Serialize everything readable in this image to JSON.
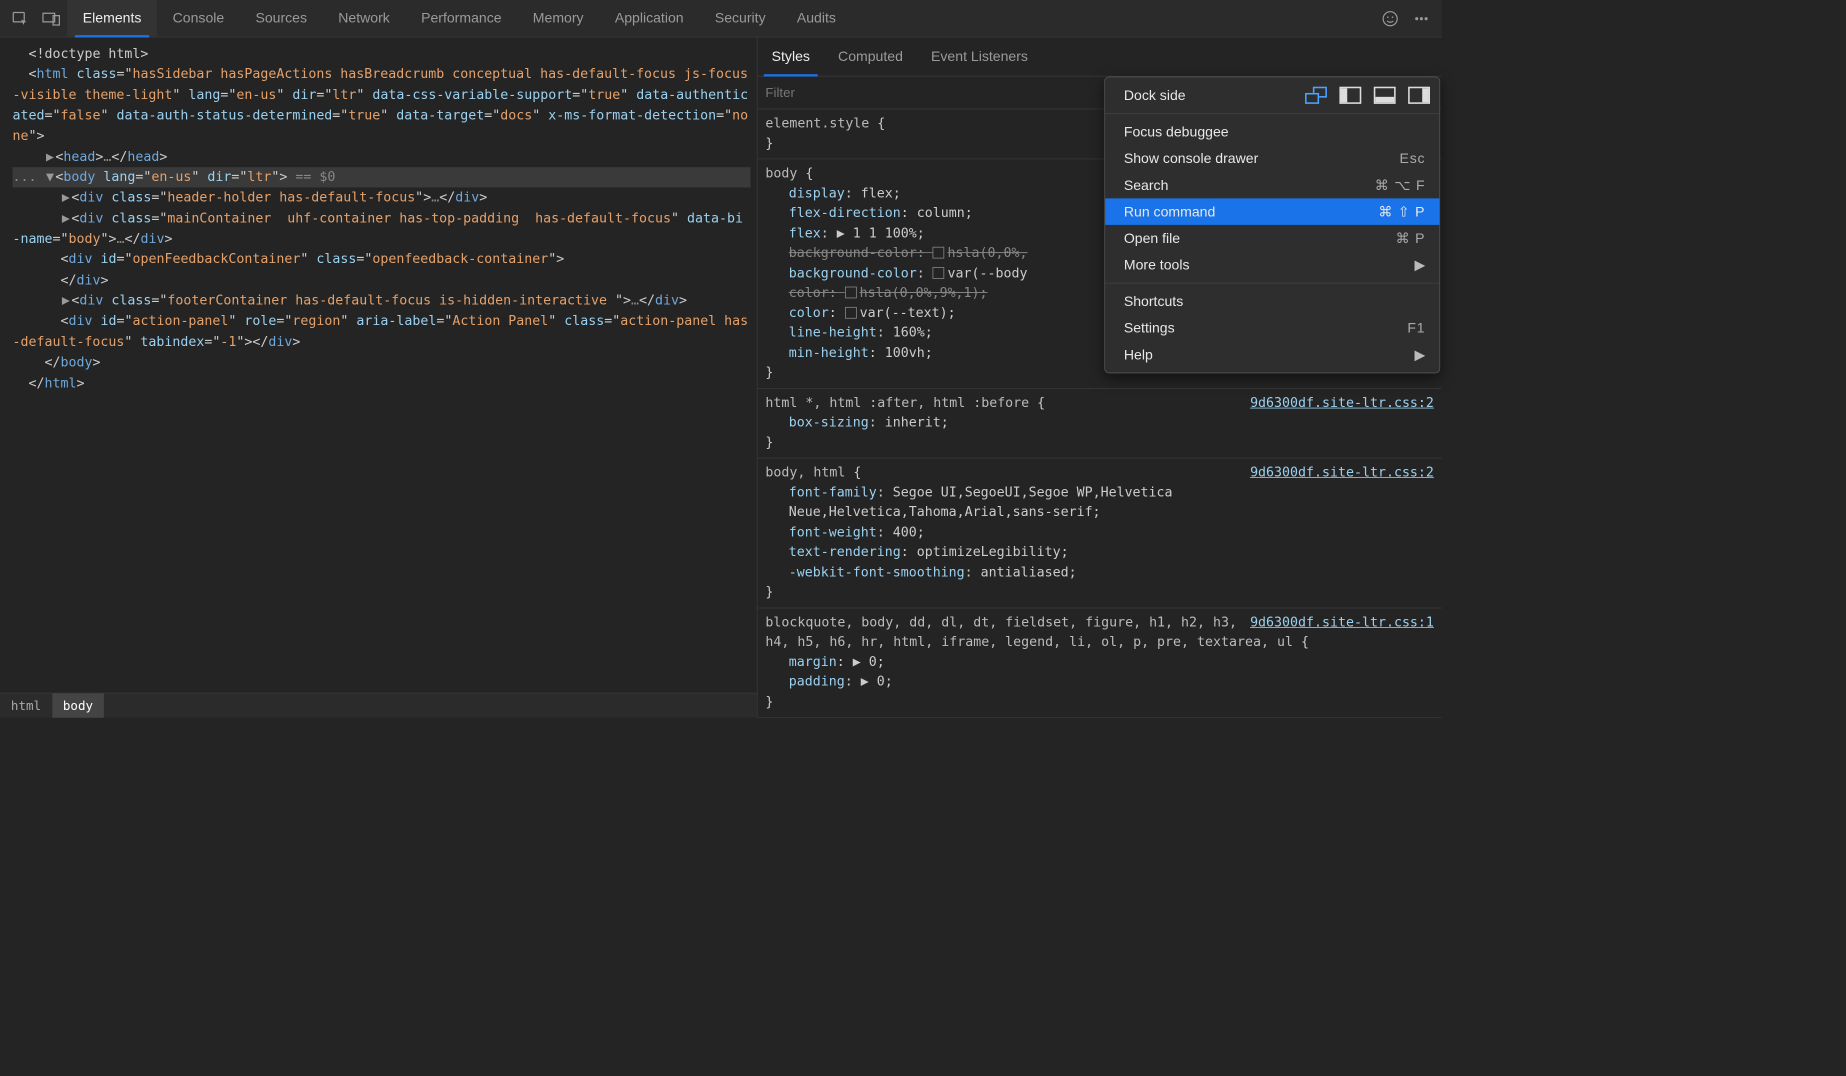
{
  "tabs": {
    "items": [
      "Elements",
      "Console",
      "Sources",
      "Network",
      "Performance",
      "Memory",
      "Application",
      "Security",
      "Audits"
    ],
    "active": "Elements"
  },
  "dom": {
    "selected_suffix": " == $0",
    "lines": [
      {
        "indent": 0,
        "raw": "<!doctype html>"
      },
      {
        "indent": 0,
        "tag": "html",
        "attrs": [
          [
            "class",
            "hasSidebar hasPageActions hasBreadcrumb conceptual has-default-focus js-focus-visible theme-light"
          ],
          [
            "lang",
            "en-us"
          ],
          [
            "dir",
            "ltr"
          ],
          [
            "data-css-variable-support",
            "true"
          ],
          [
            "data-authenticated",
            "false"
          ],
          [
            "data-auth-status-determined",
            "true"
          ],
          [
            "data-target",
            "docs"
          ],
          [
            "x-ms-format-detection",
            "none"
          ]
        ],
        "open": true
      },
      {
        "indent": 1,
        "tri": "▶",
        "tag": "head",
        "collapsed": true
      },
      {
        "indent": 1,
        "tri": "▼",
        "tag": "body",
        "attrs": [
          [
            "lang",
            "en-us"
          ],
          [
            "dir",
            "ltr"
          ]
        ],
        "selected": true,
        "open": true,
        "prefix_dots": true
      },
      {
        "indent": 2,
        "tri": "▶",
        "tag": "div",
        "attrs": [
          [
            "class",
            "header-holder has-default-focus"
          ]
        ],
        "collapsed": true
      },
      {
        "indent": 2,
        "tri": "▶",
        "tag": "div",
        "attrs": [
          [
            "class",
            "mainContainer  uhf-container has-top-padding  has-default-focus"
          ],
          [
            "data-bi-name",
            "body"
          ]
        ],
        "collapsed": true
      },
      {
        "indent": 2,
        "tag": "div",
        "attrs": [
          [
            "id",
            "openFeedbackContainer"
          ],
          [
            "class",
            "openfeedback-container"
          ]
        ],
        "closepair": true
      },
      {
        "indent": 2,
        "tri": "▶",
        "tag": "div",
        "attrs": [
          [
            "class",
            "footerContainer has-default-focus is-hidden-interactive "
          ]
        ],
        "collapsed": true
      },
      {
        "indent": 2,
        "tag": "div",
        "attrs": [
          [
            "id",
            "action-panel"
          ],
          [
            "role",
            "region"
          ],
          [
            "aria-label",
            "Action Panel"
          ],
          [
            "class",
            "action-panel has-default-focus"
          ],
          [
            "tabindex",
            "-1"
          ]
        ],
        "closepair_inline": true
      },
      {
        "indent": 1,
        "closing": "body"
      },
      {
        "indent": 0,
        "closing": "html"
      }
    ]
  },
  "breadcrumb": {
    "items": [
      "html",
      "body"
    ],
    "active": "body"
  },
  "styles_tabs": {
    "items": [
      "Styles",
      "Computed",
      "Event Listeners"
    ],
    "active": "Styles"
  },
  "filter": {
    "placeholder": "Filter",
    "value": ""
  },
  "rules": [
    {
      "selector": "element.style",
      "brace": "{",
      "props": [],
      "close": "}"
    },
    {
      "selector": "body",
      "brace": "{",
      "props": [
        {
          "name": "display",
          "value": "flex;"
        },
        {
          "name": "flex-direction",
          "value": "column;"
        },
        {
          "name": "flex",
          "value": "▶ 1 1 100%;"
        },
        {
          "name": "background-color",
          "value": "hsla(0,0%,",
          "strike": true,
          "swatch": true
        },
        {
          "name": "background-color",
          "value": "var(--body",
          "swatch": true
        },
        {
          "name": "color",
          "value": "hsla(0,0%,9%,1);",
          "strike": true,
          "swatch": true
        },
        {
          "name": "color",
          "value": "var(--text);",
          "swatch": true
        },
        {
          "name": "line-height",
          "value": "160%;"
        },
        {
          "name": "min-height",
          "value": "100vh;"
        }
      ],
      "close": "}"
    },
    {
      "selector": "html *, html :after, html :before",
      "brace": "{",
      "link": "9d6300df.site-ltr.css:2",
      "props": [
        {
          "name": "box-sizing",
          "value": "inherit;"
        }
      ],
      "close": "}"
    },
    {
      "selector": "body, html",
      "brace": "{",
      "link": "9d6300df.site-ltr.css:2",
      "props": [
        {
          "name": "font-family",
          "value": "Segoe UI,SegoeUI,Segoe WP,Helvetica Neue,Helvetica,Tahoma,Arial,sans-serif;"
        },
        {
          "name": "font-weight",
          "value": "400;"
        },
        {
          "name": "text-rendering",
          "value": "optimizeLegibility;"
        },
        {
          "name": "-webkit-font-smoothing",
          "value": "antialiased;"
        }
      ],
      "close": "}"
    },
    {
      "selector": "blockquote, body, dd, dl, dt, fieldset, figure, h1, h2, h3, h4, h5, h6, hr, html, iframe, legend, li, ol, p, pre, textarea, ul",
      "brace": "{",
      "link": "9d6300df.site-ltr.css:1",
      "props": [
        {
          "name": "margin",
          "value": "▶ 0;"
        },
        {
          "name": "padding",
          "value": "▶ 0;"
        }
      ],
      "close": "}"
    }
  ],
  "context_menu": {
    "dock_label": "Dock side",
    "items": [
      {
        "type": "sep"
      },
      {
        "label": "Focus debuggee"
      },
      {
        "label": "Show console drawer",
        "kbd": "Esc"
      },
      {
        "label": "Search",
        "kbd": "⌘ ⌥ F"
      },
      {
        "label": "Run command",
        "kbd": "⌘ ⇧ P",
        "highlight": true
      },
      {
        "label": "Open file",
        "kbd": "⌘ P"
      },
      {
        "label": "More tools",
        "arrow": true
      },
      {
        "type": "sep"
      },
      {
        "label": "Shortcuts"
      },
      {
        "label": "Settings",
        "kbd": "F1"
      },
      {
        "label": "Help",
        "arrow": true
      }
    ]
  }
}
